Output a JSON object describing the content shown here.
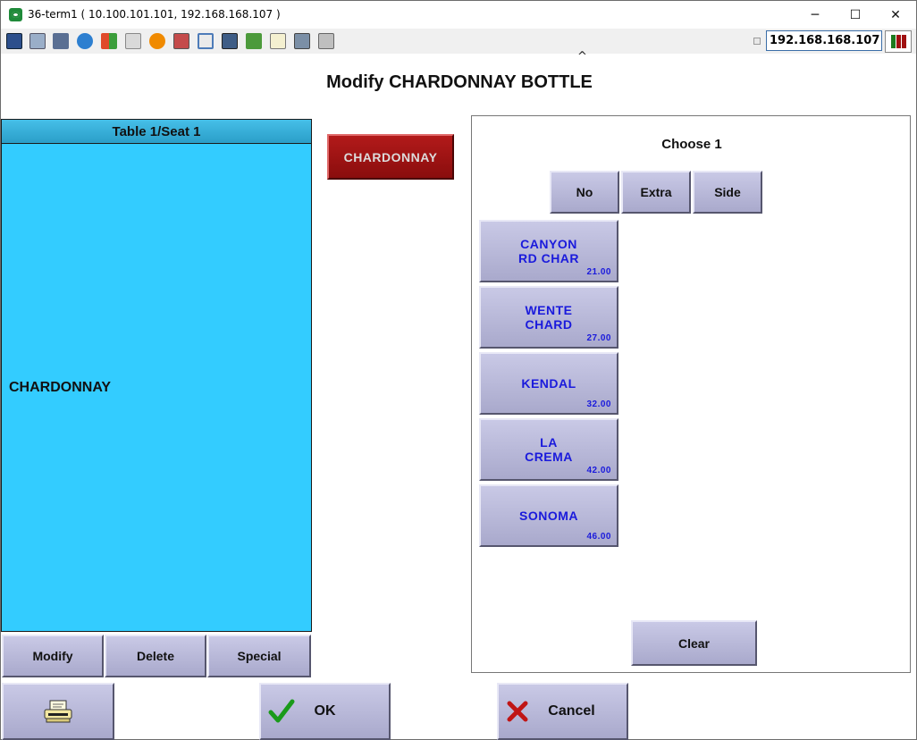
{
  "window": {
    "title": "36-term1 ( 10.100.101.101, 192.168.168.107 )",
    "minimize": "─",
    "maximize": "☐",
    "close": "✕"
  },
  "toolbar": {
    "icons": [
      "monitor-icon",
      "windows-icon",
      "tools-icon",
      "refresh-icon",
      "flag-icon",
      "keyboard-icon",
      "alert-icon",
      "network-icon",
      "fullscreen-icon",
      "display-icon",
      "download-icon",
      "notepad-icon",
      "picture-icon",
      "chat-icon"
    ],
    "ip_address": "192.168.168.107",
    "caret": "^"
  },
  "page": {
    "title": "Modify CHARDONNAY BOTTLE"
  },
  "seat": {
    "header": "Table 1/Seat 1",
    "item": "CHARDONNAY"
  },
  "seat_actions": {
    "modify": "Modify",
    "delete": "Delete",
    "special": "Special"
  },
  "selected_item": "CHARDONNAY",
  "choices": {
    "label": "Choose 1",
    "modifiers": {
      "no": "No",
      "extra": "Extra",
      "side": "Side"
    },
    "wines": [
      {
        "line1": "CANYON",
        "line2": "RD CHAR",
        "price": "21.00"
      },
      {
        "line1": "WENTE",
        "line2": "CHARD",
        "price": "27.00"
      },
      {
        "line1": "KENDAL",
        "line2": "",
        "price": "32.00"
      },
      {
        "line1": "LA",
        "line2": "CREMA",
        "price": "42.00"
      },
      {
        "line1": "SONOMA",
        "line2": "",
        "price": "46.00"
      }
    ],
    "clear": "Clear"
  },
  "footer": {
    "ok": "OK",
    "cancel": "Cancel"
  },
  "colors": {
    "seat_panel": "#33ccff",
    "item_button": "#a01414",
    "button_face": "#b9b9d8",
    "wine_text": "#1a1adc"
  }
}
